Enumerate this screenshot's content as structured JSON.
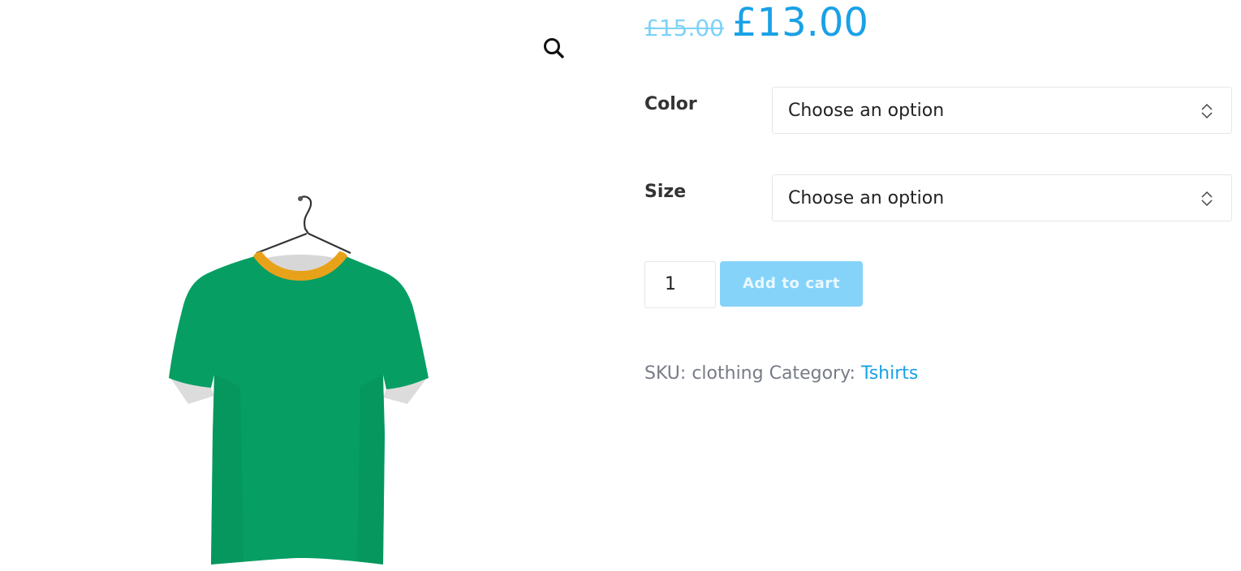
{
  "gallery": {
    "zoom_icon": "magnifier-icon",
    "image_icon": "green-tshirt-on-hanger"
  },
  "product": {
    "price_old": "£15.00",
    "price_new": "£13.00",
    "colors": {
      "price": "#1aa1e6",
      "price_old": "#7dd3f7",
      "button": "#85d3f9",
      "shirt": "#069e63",
      "collar": "#e8a21a"
    }
  },
  "variations": {
    "color": {
      "label": "Color",
      "selected": "Choose an option"
    },
    "size": {
      "label": "Size",
      "selected": "Choose an option"
    }
  },
  "cart": {
    "quantity": "1",
    "add_label": "Add to cart"
  },
  "meta": {
    "sku_label": "SKU:",
    "sku_value": "clothing",
    "category_label": "Category:",
    "category_value": "Tshirts"
  }
}
